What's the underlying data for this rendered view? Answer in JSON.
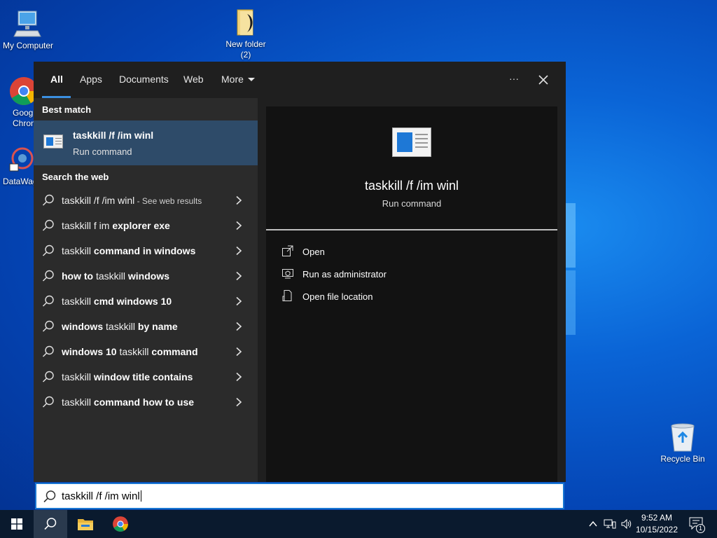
{
  "desktop": {
    "icons": {
      "my_computer": "My Computer",
      "new_folder_line1": "New folder",
      "new_folder_line2": "(2)",
      "chrome_line1": "Goog",
      "chrome_line2": "Chron",
      "datawag": "DataWag",
      "recycle_bin": "Recycle Bin"
    }
  },
  "search_panel": {
    "tabs": {
      "all": "All",
      "apps": "Apps",
      "documents": "Documents",
      "web": "Web",
      "more": "More"
    },
    "more_options_label": "···",
    "close_label": "✕",
    "best_match_heading": "Best match",
    "best_match": {
      "title": "taskkill /f /im winl",
      "subtitle": "Run command"
    },
    "search_web_heading": "Search the web",
    "web_results": [
      {
        "prefix": "taskkill /f /im winl",
        "bold": "",
        "suffix": " - See web results"
      },
      {
        "prefix": "taskkill f im ",
        "bold": "explorer exe",
        "suffix": ""
      },
      {
        "prefix": "taskkill ",
        "bold": "command in windows",
        "suffix": ""
      },
      {
        "prefix": "",
        "bold": "how to",
        "suffix": " taskkill ",
        "bold2": "windows"
      },
      {
        "prefix": "taskkill ",
        "bold": "cmd windows 10",
        "suffix": ""
      },
      {
        "prefix": "",
        "bold": "windows",
        "suffix": " taskkill ",
        "bold2": "by name"
      },
      {
        "prefix": "",
        "bold": "windows 10",
        "suffix": " taskkill ",
        "bold2": "command"
      },
      {
        "prefix": "taskkill ",
        "bold": "window title contains",
        "suffix": ""
      },
      {
        "prefix": "taskkill ",
        "bold": "command how to use",
        "suffix": ""
      }
    ],
    "preview": {
      "title": "taskkill /f /im winl",
      "subtitle": "Run command"
    },
    "actions": {
      "open": "Open",
      "run_as_admin": "Run as administrator",
      "open_file_location": "Open file location"
    },
    "search_box": {
      "value": "taskkill /f /im winl"
    }
  },
  "taskbar": {
    "time": "9:52 AM",
    "date": "10/15/2022",
    "notification_count": "1"
  },
  "colors": {
    "accent": "#1976d2",
    "selected_row": "#2e4b69",
    "panel_dark": "#1f1f1f"
  }
}
